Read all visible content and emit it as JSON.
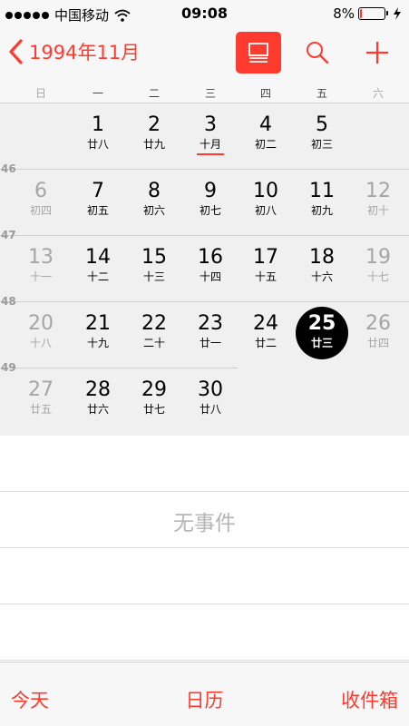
{
  "status_bar": {
    "carrier": "中国移动",
    "time": "09:08",
    "battery_percent": "8%",
    "battery_level": 0.08,
    "icons": [
      "signal-dots-icon",
      "wifi-icon",
      "battery-icon",
      "charging-bolt-icon"
    ]
  },
  "nav": {
    "back_label": "1994年11月",
    "buttons": [
      "list-view-icon",
      "search-icon",
      "add-icon"
    ],
    "accent_color": "#ff3b30"
  },
  "weekdays": [
    "日",
    "一",
    "二",
    "三",
    "四",
    "五",
    "六"
  ],
  "calendar": {
    "weeks": [
      {
        "week_number": "",
        "days": [
          null,
          {
            "day": "1",
            "lunar": "廿八"
          },
          {
            "day": "2",
            "lunar": "廿九"
          },
          {
            "day": "3",
            "lunar": "十月",
            "marked": true
          },
          {
            "day": "4",
            "lunar": "初二"
          },
          {
            "day": "5",
            "lunar": "初三"
          },
          null
        ]
      },
      {
        "week_number": "46",
        "days": [
          {
            "day": "6",
            "lunar": "初四"
          },
          {
            "day": "7",
            "lunar": "初五"
          },
          {
            "day": "8",
            "lunar": "初六"
          },
          {
            "day": "9",
            "lunar": "初七"
          },
          {
            "day": "10",
            "lunar": "初八"
          },
          {
            "day": "11",
            "lunar": "初九"
          },
          {
            "day": "12",
            "lunar": "初十"
          }
        ]
      },
      {
        "week_number": "47",
        "days": [
          {
            "day": "13",
            "lunar": "十一"
          },
          {
            "day": "14",
            "lunar": "十二"
          },
          {
            "day": "15",
            "lunar": "十三"
          },
          {
            "day": "16",
            "lunar": "十四"
          },
          {
            "day": "17",
            "lunar": "十五"
          },
          {
            "day": "18",
            "lunar": "十六"
          },
          {
            "day": "19",
            "lunar": "十七"
          }
        ]
      },
      {
        "week_number": "48",
        "days": [
          {
            "day": "20",
            "lunar": "十八"
          },
          {
            "day": "21",
            "lunar": "十九"
          },
          {
            "day": "22",
            "lunar": "二十"
          },
          {
            "day": "23",
            "lunar": "廿一"
          },
          {
            "day": "24",
            "lunar": "廿二"
          },
          {
            "day": "25",
            "lunar": "廿三",
            "selected": true
          },
          {
            "day": "26",
            "lunar": "廿四"
          }
        ]
      },
      {
        "week_number": "49",
        "days": [
          {
            "day": "27",
            "lunar": "廿五"
          },
          {
            "day": "28",
            "lunar": "廿六"
          },
          {
            "day": "29",
            "lunar": "廿七"
          },
          {
            "day": "30",
            "lunar": "廿八"
          },
          null,
          null,
          null
        ]
      }
    ]
  },
  "events": {
    "empty_text": "无事件"
  },
  "tabbar": {
    "today": "今天",
    "calendar": "日历",
    "inbox": "收件箱"
  }
}
